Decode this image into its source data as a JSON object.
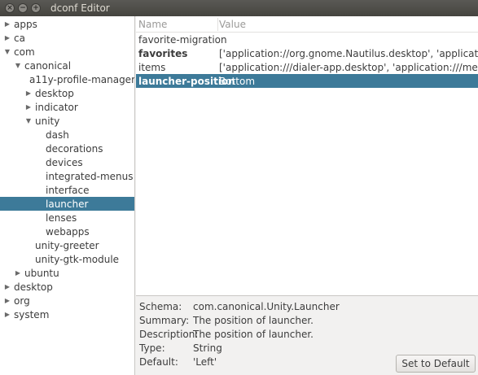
{
  "window": {
    "title": "dconf Editor"
  },
  "tree": [
    {
      "label": "apps",
      "expander": "▶"
    },
    {
      "label": "ca",
      "expander": "▶"
    },
    {
      "label": "com",
      "expander": "▼"
    },
    {
      "label": "canonical",
      "expander": "▼"
    },
    {
      "label": "a11y-profile-manager",
      "expander": ""
    },
    {
      "label": "desktop",
      "expander": "▶"
    },
    {
      "label": "indicator",
      "expander": "▶"
    },
    {
      "label": "unity",
      "expander": "▼"
    },
    {
      "label": "dash",
      "expander": ""
    },
    {
      "label": "decorations",
      "expander": ""
    },
    {
      "label": "devices",
      "expander": ""
    },
    {
      "label": "integrated-menus",
      "expander": ""
    },
    {
      "label": "interface",
      "expander": ""
    },
    {
      "label": "launcher",
      "expander": ""
    },
    {
      "label": "lenses",
      "expander": ""
    },
    {
      "label": "webapps",
      "expander": ""
    },
    {
      "label": "unity-greeter",
      "expander": ""
    },
    {
      "label": "unity-gtk-module",
      "expander": ""
    },
    {
      "label": "ubuntu",
      "expander": "▶"
    },
    {
      "label": "desktop",
      "expander": "▶"
    },
    {
      "label": "org",
      "expander": "▶"
    },
    {
      "label": "system",
      "expander": "▶"
    }
  ],
  "keys": {
    "col_name": "Name",
    "col_value": "Value",
    "rows": [
      {
        "name": "favorite-migration",
        "value": ""
      },
      {
        "name": "favorites",
        "value": "['application://org.gnome.Nautilus.desktop', 'application://firefox.desktop'"
      },
      {
        "name": "items",
        "value": "['application:///dialer-app.desktop', 'application:///messaging-app.desktop'"
      },
      {
        "name": "launcher-position",
        "value": "Bottom"
      }
    ]
  },
  "details": {
    "schema_label": "Schema:",
    "schema_value": "com.canonical.Unity.Launcher",
    "summary_label": "Summary:",
    "summary_value": "The position of launcher.",
    "description_label": "Description:",
    "description_value": "The position of launcher.",
    "type_label": "Type:",
    "type_value": "String",
    "default_label": "Default:",
    "default_value": "'Left'",
    "reset_button": "Set to Default"
  },
  "colors": {
    "selection": "#3d7a99",
    "titlebar": "#45443f"
  }
}
